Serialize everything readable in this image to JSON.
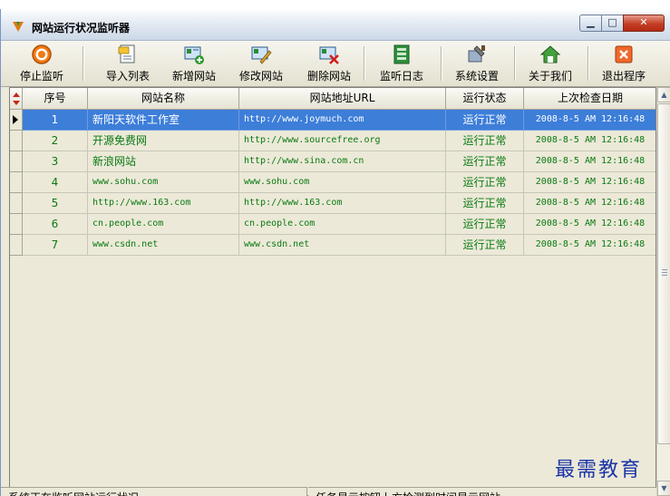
{
  "window": {
    "title": "网站运行状况监听器",
    "controls": {
      "minimize": "▁",
      "maximize": "□",
      "close": "✕"
    }
  },
  "toolbar": [
    {
      "label": "停止监听",
      "icon": "stop-circle-icon"
    },
    {
      "label": "导入列表",
      "icon": "import-list-icon"
    },
    {
      "label": "新增网站",
      "icon": "add-site-icon"
    },
    {
      "label": "修改网站",
      "icon": "edit-site-icon"
    },
    {
      "label": "删除网站",
      "icon": "delete-site-icon"
    },
    {
      "label": "监听日志",
      "icon": "log-book-icon"
    },
    {
      "label": "系统设置",
      "icon": "settings-tools-icon"
    },
    {
      "label": "关于我们",
      "icon": "home-icon"
    },
    {
      "label": "退出程序",
      "icon": "exit-icon"
    }
  ],
  "table": {
    "columns": [
      "序号",
      "网站名称",
      "网站地址URL",
      "运行状态",
      "上次检查日期"
    ],
    "rows": [
      {
        "no": "1",
        "name": "新阳天软件工作室",
        "url": "http://www.joymuch.com",
        "status": "运行正常",
        "last_check": "2008-8-5 AM 12:16:48",
        "selected": true
      },
      {
        "no": "2",
        "name": "开源免费网",
        "url": "http://www.sourcefree.org",
        "status": "运行正常",
        "last_check": "2008-8-5 AM 12:16:48"
      },
      {
        "no": "3",
        "name": "新浪网站",
        "url": "http://www.sina.com.cn",
        "status": "运行正常",
        "last_check": "2008-8-5 AM 12:16:48"
      },
      {
        "no": "4",
        "name": "www.sohu.com",
        "url": "www.sohu.com",
        "status": "运行正常",
        "last_check": "2008-8-5 AM 12:16:48"
      },
      {
        "no": "5",
        "name": "http://www.163.com",
        "url": "http://www.163.com",
        "status": "运行正常",
        "last_check": "2008-8-5 AM 12:16:48"
      },
      {
        "no": "6",
        "name": "cn.people.com",
        "url": "cn.people.com",
        "status": "运行正常",
        "last_check": "2008-8-5 AM 12:16:48"
      },
      {
        "no": "7",
        "name": "www.csdn.net",
        "url": "www.csdn.net",
        "status": "运行正常",
        "last_check": "2008-8-5 AM 12:16:48"
      }
    ]
  },
  "statusbar": {
    "left": "系统正在监听网站运行状况...",
    "right": "任务显示按钮上方检测到时间显示网站"
  },
  "watermark": "最需教育",
  "colors": {
    "selected_row": "#3d7ed9",
    "row_text": "#0a7a12",
    "close_button": "#c33d24"
  }
}
